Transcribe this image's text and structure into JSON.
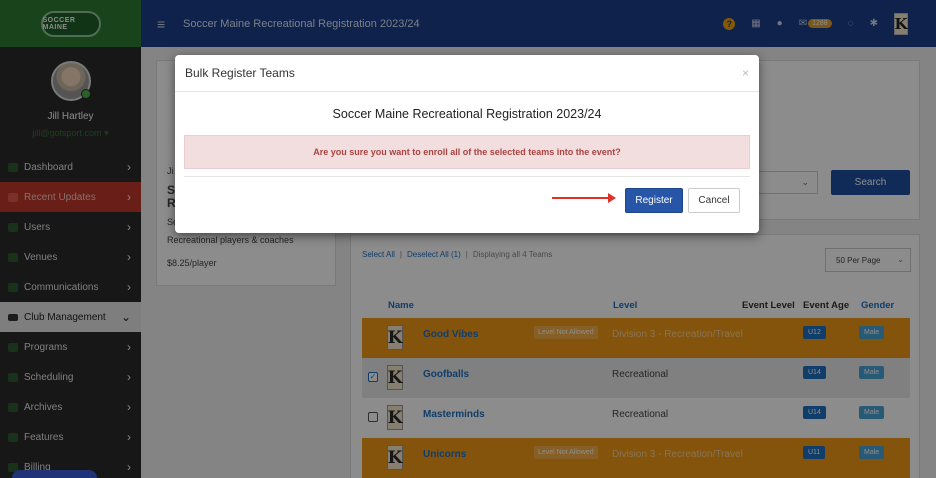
{
  "app": {
    "title": "Soccer Maine Recreational Registration 2023/24",
    "logo_text": "SOCCER MAINE",
    "mail_count": "1288",
    "k_logo": "K"
  },
  "user": {
    "name": "Jill Hartley",
    "email": "jill@gotsport.com"
  },
  "sidebar": {
    "items": [
      {
        "label": "Dashboard",
        "icon": "dashboard-icon"
      },
      {
        "label": "Recent Updates",
        "icon": "updates-icon"
      },
      {
        "label": "Users",
        "icon": "users-icon"
      },
      {
        "label": "Venues",
        "icon": "venues-icon"
      },
      {
        "label": "Communications",
        "icon": "communications-icon"
      },
      {
        "label": "Club Management",
        "icon": "club-icon"
      },
      {
        "label": "Programs",
        "icon": "programs-icon"
      },
      {
        "label": "Scheduling",
        "icon": "scheduling-icon"
      },
      {
        "label": "Archives",
        "icon": "archives-icon"
      },
      {
        "label": "Features",
        "icon": "features-icon"
      },
      {
        "label": "Billing",
        "icon": "billing-icon"
      }
    ]
  },
  "left_panel": {
    "line1": "Ji",
    "line2": "S",
    "line3": "R",
    "line4": "Se",
    "desc": "Recreational players & coaches",
    "price": "$8.25/player"
  },
  "search": {
    "button_label": "Search"
  },
  "teams": {
    "select_all": "Select All",
    "deselect_all": "Deselect All (1)",
    "displaying": "Displaying all 4 Teams",
    "per_page": "50 Per Page",
    "columns": {
      "name": "Name",
      "level": "Level",
      "event_level": "Event Level",
      "event_age": "Event Age",
      "gender": "Gender"
    },
    "rows": [
      {
        "name": "Good Vibes",
        "badge": "Level Not Allowed",
        "level": "Division 3 - Recreation/Travel",
        "age": "U12",
        "gender": "Male"
      },
      {
        "name": "Goofballs",
        "badge": "",
        "level": "Recreational",
        "age": "U14",
        "gender": "Male",
        "checked": "✓"
      },
      {
        "name": "Masterminds",
        "badge": "",
        "level": "Recreational",
        "age": "U14",
        "gender": "Male"
      },
      {
        "name": "Unicorns",
        "badge": "Level Not Allowed",
        "level": "Division 3 - Recreation/Travel",
        "age": "U11",
        "gender": "Male"
      }
    ]
  },
  "modal": {
    "title": "Bulk Register Teams",
    "close": "×",
    "event_name": "Soccer Maine Recreational Registration 2023/24",
    "alert": "Are you sure you want to enroll all of the selected teams into the event?",
    "register_label": "Register",
    "cancel_label": "Cancel"
  },
  "colors": {
    "topbar": "#1a3e8a",
    "sidebar": "#2b2b2b",
    "logo_bg": "#2e7d32",
    "active_nav": "#c0392b",
    "register_button": "#2756a8",
    "alert_bg": "#f2dede",
    "alert_text": "#a94442",
    "row_orange": "#f29a17",
    "arrow": "#e0302a"
  }
}
